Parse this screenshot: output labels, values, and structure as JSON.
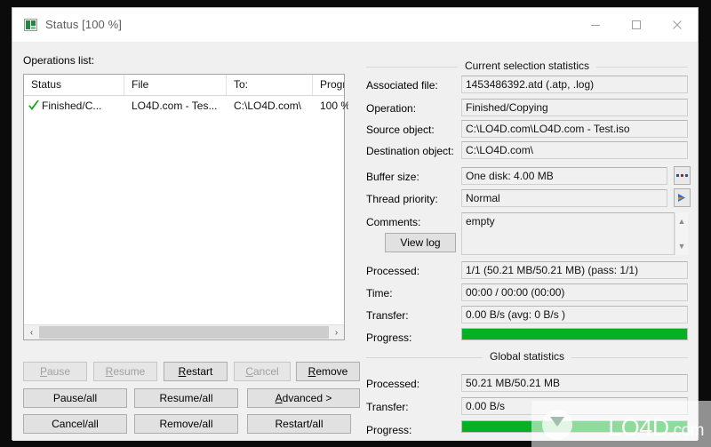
{
  "window": {
    "title": "Status [100 %]",
    "icon": "app-icon",
    "controls": {
      "minimize": "minimize-icon",
      "maximize": "maximize-icon",
      "close": "close-icon"
    }
  },
  "left": {
    "operations_label": "Operations list:",
    "columns": [
      "Status",
      "File",
      "To:",
      "Progr..."
    ],
    "rows": [
      {
        "status": "Finished/C...",
        "file": "LO4D.com - Tes...",
        "to": "C:\\LO4D.com\\",
        "progress": "100 %",
        "icon": "green-check-icon"
      }
    ],
    "scrollbar": {
      "left_arrow": "‹",
      "right_arrow": "›"
    },
    "buttons_row1": [
      {
        "label": "Pause",
        "mnemonic": "P",
        "enabled": false
      },
      {
        "label": "Resume",
        "mnemonic": "R",
        "enabled": false
      },
      {
        "label": "Restart",
        "mnemonic": "R",
        "enabled": true
      },
      {
        "label": "Cancel",
        "mnemonic": "C",
        "enabled": false
      },
      {
        "label": "Remove",
        "mnemonic": "R",
        "enabled": true
      }
    ],
    "buttons_row2": [
      {
        "label": "Pause/all",
        "enabled": true
      },
      {
        "label": "Resume/all",
        "enabled": true
      },
      {
        "label": "Advanced >",
        "mnemonic": "A",
        "enabled": true
      }
    ],
    "buttons_row3": [
      {
        "label": "Cancel/all",
        "enabled": true
      },
      {
        "label": "Remove/all",
        "enabled": true
      },
      {
        "label": "Restart/all",
        "enabled": true
      }
    ]
  },
  "current_selection": {
    "group_title": "Current selection statistics",
    "fields": [
      {
        "label": "Associated file:",
        "value": "1453486392.atd (.atp, .log)"
      },
      {
        "label": "Operation:",
        "value": "Finished/Copying"
      },
      {
        "label": "Source object:",
        "value": "C:\\LO4D.com\\LO4D.com - Test.iso"
      },
      {
        "label": "Destination object:",
        "value": "C:\\LO4D.com\\"
      },
      {
        "label": "Buffer size:",
        "value": "One disk: 4.00 MB"
      },
      {
        "label": "Thread priority:",
        "value": "Normal"
      }
    ],
    "buffer_button": "browse-dots-icon",
    "priority_button": "priority-arrow-icon",
    "comments_label": "Comments:",
    "comments_value": "empty",
    "view_log_label": "View log",
    "stats": [
      {
        "label": "Processed:",
        "value": "1/1 (50.21 MB/50.21 MB) (pass: 1/1)"
      },
      {
        "label": "Time:",
        "value": "00:00 / 00:00 (00:00)"
      },
      {
        "label": "Transfer:",
        "value": "0.00 B/s (avg: 0 B/s )"
      }
    ],
    "progress_label": "Progress:",
    "progress_percent": 100
  },
  "global": {
    "group_title": "Global statistics",
    "stats": [
      {
        "label": "Processed:",
        "value": "50.21 MB/50.21 MB"
      },
      {
        "label": "Transfer:",
        "value": "0.00 B/s"
      }
    ],
    "progress_label": "Progress:",
    "progress_percent": 100
  },
  "watermark": {
    "text": "LO4D",
    "suffix": ".com"
  },
  "colors": {
    "progress_green": "#06b025",
    "window_bg": "#f0f0f0",
    "titlebar_bg": "#ffffff",
    "check_green": "#16a615"
  }
}
